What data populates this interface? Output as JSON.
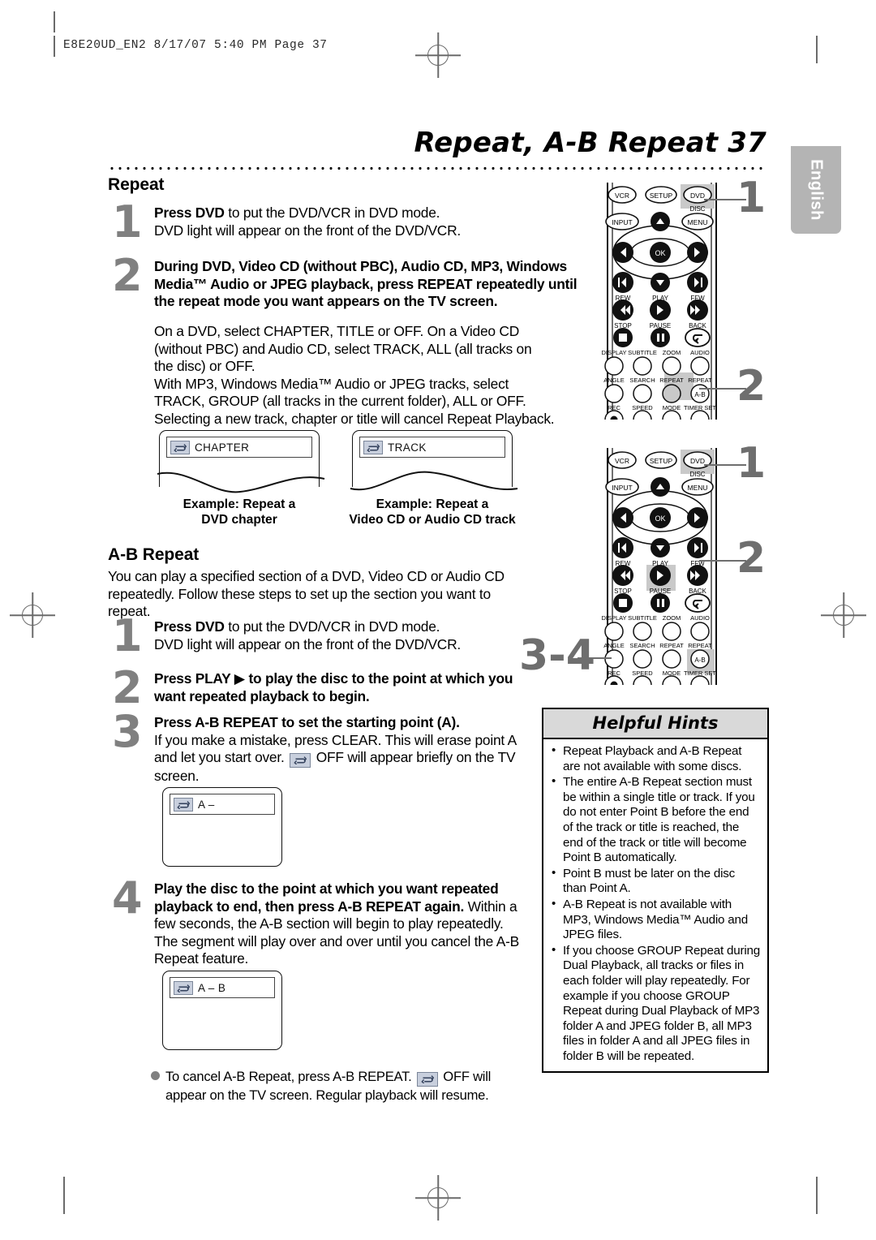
{
  "print": {
    "slug": "E8E20UD_EN2  8/17/07  5:40 PM  Page 37"
  },
  "page": {
    "title": "Repeat, A-B Repeat  37",
    "side_tab": "English"
  },
  "repeat_section": {
    "heading": "Repeat",
    "steps": [
      {
        "num": "1",
        "lead": "Press DVD",
        "lead_rest": " to put the DVD/VCR in DVD mode.",
        "line2": "DVD light will appear on the front of the DVD/VCR."
      },
      {
        "num": "2",
        "bold_text": "During DVD, Video CD (without PBC), Audio CD, MP3, Windows Media™ Audio or JPEG playback, press REPEAT repeatedly until the repeat mode you want appears on the TV screen.",
        "paragraph_lines": [
          "On a DVD, select CHAPTER, TITLE or OFF. On a Video CD",
          "(without PBC) and Audio CD, select TRACK, ALL (all tracks on",
          "the disc) or OFF.",
          "With MP3, Windows Media™ Audio or JPEG tracks, select",
          "TRACK, GROUP (all tracks in the current folder), ALL or OFF.",
          "Selecting a new track, chapter or title will cancel Repeat Playback."
        ]
      }
    ],
    "examples": [
      {
        "osd_label": "CHAPTER",
        "caption_line1": "Example: Repeat a",
        "caption_line2": "DVD chapter"
      },
      {
        "osd_label": "TRACK",
        "caption_line1": "Example: Repeat a",
        "caption_line2": "Video CD or Audio CD track"
      }
    ]
  },
  "ab_section": {
    "heading": "A-B Repeat",
    "intro_lines": [
      "You can play a specified section of a DVD, Video CD or Audio CD",
      "repeatedly. Follow these steps to set up the section you want to",
      "repeat."
    ],
    "steps": [
      {
        "num": "1",
        "lead": "Press DVD",
        "lead_rest": " to put the DVD/VCR in DVD mode.",
        "line2": "DVD light will appear on the front of the DVD/VCR."
      },
      {
        "num": "2",
        "bold_text": "Press PLAY ▶ to play the disc to the point at which you want repeated playback to begin."
      },
      {
        "num": "3",
        "bold_text": "Press A-B REPEAT to set the starting point (A).",
        "rest_a": "If you make a mistake, press CLEAR. This will erase point A and let you start over.",
        "rest_b": "OFF will appear briefly on the TV screen."
      },
      {
        "num": "4",
        "bold_text": "Play the disc to the point at which you want repeated playback to end, then press A-B REPEAT again.",
        "rest": " Within a few seconds, the A-B section will begin to play repeatedly. The segment will play over and over until you cancel the A-B Repeat feature."
      }
    ],
    "screens": [
      {
        "osd_label": "A –"
      },
      {
        "osd_label": "A – B"
      }
    ],
    "cancel_note_a": "To cancel A-B Repeat, press A-B REPEAT.",
    "cancel_note_b": "OFF will appear on the TV screen. Regular playback will resume."
  },
  "hints": {
    "title": "Helpful Hints",
    "items": [
      "Repeat Playback and A-B Repeat are not available with some discs.",
      "The entire A-B Repeat section must be within a single title or track. If you do not enter Point B before the end of the track or title is reached, the end of the track or title will become Point B automatically.",
      "Point B must be later on the disc than Point A.",
      "A-B Repeat is not available with MP3, Windows Media™ Audio and JPEG files.",
      "If you choose GROUP Repeat during Dual Playback, all tracks or files in each folder will play repeatedly. For example if you choose GROUP Repeat during Dual Playback of MP3 folder A and JPEG folder B, all MP3 files in folder A and all JPEG files in folder B will be repeated."
    ]
  },
  "remotes": [
    {
      "id": "remote-top",
      "callouts": [
        "1",
        "2"
      ],
      "highlighted_buttons": [
        "DVD",
        "REPEAT"
      ],
      "buttons": {
        "row1": [
          "VCR",
          "SETUP",
          "DVD"
        ],
        "disc_label": "DISC",
        "row2": [
          "INPUT",
          "MENU"
        ],
        "ok": "OK",
        "transport_labels": [
          "REW",
          "PLAY",
          "FFW"
        ],
        "transport2_labels": [
          "STOP",
          "PAUSE",
          "BACK"
        ],
        "row_display": [
          "DISPLAY",
          "SUBTITLE",
          "ZOOM",
          "AUDIO"
        ],
        "row_angle": [
          "ANGLE",
          "SEARCH",
          "REPEAT",
          "REPEAT"
        ],
        "ab_label": "A-B",
        "row_rec": [
          "REC",
          "SPEED",
          "MODE",
          "TIMER SET"
        ]
      }
    },
    {
      "id": "remote-bottom",
      "callouts": [
        "1",
        "2",
        "3-4"
      ],
      "highlighted_buttons": [
        "DVD",
        "PLAY",
        "A-B"
      ],
      "buttons": {
        "row1": [
          "VCR",
          "SETUP",
          "DVD"
        ],
        "disc_label": "DISC",
        "row2": [
          "INPUT",
          "MENU"
        ],
        "ok": "OK",
        "transport_labels": [
          "REW",
          "PLAY",
          "FFW"
        ],
        "transport2_labels": [
          "STOP",
          "PAUSE",
          "BACK"
        ],
        "row_display": [
          "DISPLAY",
          "SUBTITLE",
          "ZOOM",
          "AUDIO"
        ],
        "row_angle": [
          "ANGLE",
          "SEARCH",
          "REPEAT",
          "REPEAT"
        ],
        "ab_label": "A-B",
        "row_rec": [
          "REC",
          "SPEED",
          "MODE",
          "TIMER SET"
        ]
      }
    }
  ],
  "colors": {
    "step_number": "#808080",
    "callout": "#6e6e6e",
    "hint_header_bg": "#d9d9d9",
    "tab_bg": "#b4b4b4",
    "osd_icon_bg": "#c8cfdd",
    "highlight": "#c9c9c9"
  }
}
